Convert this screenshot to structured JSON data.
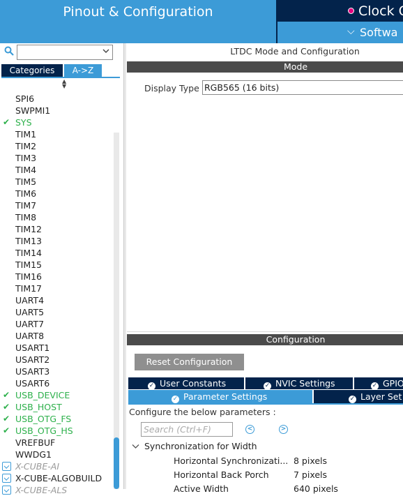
{
  "header": {
    "main_tab": "Pinout & Configuration",
    "clock_tab": "Clock C",
    "software_tab": "Softwa",
    "chevron_glyph": "❯"
  },
  "left_panel": {
    "search": {
      "value": "",
      "placeholder": ""
    },
    "tabs": {
      "categories": "Categories",
      "az": "A->Z",
      "active": "A->Z"
    },
    "items": [
      {
        "label": "SPI6",
        "status": "none"
      },
      {
        "label": "SWPMI1",
        "status": "none"
      },
      {
        "label": "SYS",
        "status": "configured"
      },
      {
        "label": "TIM1",
        "status": "none"
      },
      {
        "label": "TIM2",
        "status": "none"
      },
      {
        "label": "TIM3",
        "status": "none"
      },
      {
        "label": "TIM4",
        "status": "none"
      },
      {
        "label": "TIM5",
        "status": "none"
      },
      {
        "label": "TIM6",
        "status": "none"
      },
      {
        "label": "TIM7",
        "status": "none"
      },
      {
        "label": "TIM8",
        "status": "none"
      },
      {
        "label": "TIM12",
        "status": "none"
      },
      {
        "label": "TIM13",
        "status": "none"
      },
      {
        "label": "TIM14",
        "status": "none"
      },
      {
        "label": "TIM15",
        "status": "none"
      },
      {
        "label": "TIM16",
        "status": "none"
      },
      {
        "label": "TIM17",
        "status": "none"
      },
      {
        "label": "UART4",
        "status": "none"
      },
      {
        "label": "UART5",
        "status": "none"
      },
      {
        "label": "UART7",
        "status": "none"
      },
      {
        "label": "UART8",
        "status": "none"
      },
      {
        "label": "USART1",
        "status": "none"
      },
      {
        "label": "USART2",
        "status": "none"
      },
      {
        "label": "USART3",
        "status": "none"
      },
      {
        "label": "USART6",
        "status": "none"
      },
      {
        "label": "USB_DEVICE",
        "status": "configured"
      },
      {
        "label": "USB_HOST",
        "status": "configured"
      },
      {
        "label": "USB_OTG_FS",
        "status": "configured"
      },
      {
        "label": "USB_OTG_HS",
        "status": "configured"
      },
      {
        "label": "VREFBUF",
        "status": "none"
      },
      {
        "label": "WWDG1",
        "status": "none"
      },
      {
        "label": "X-CUBE-AI",
        "status": "package-faded"
      },
      {
        "label": "X-CUBE-ALGOBUILD",
        "status": "package"
      },
      {
        "label": "X-CUBE-ALS",
        "status": "package-faded"
      }
    ]
  },
  "main": {
    "title": "LTDC Mode and Configuration",
    "mode_header": "Mode",
    "display_type_label": "Display Type",
    "display_type_value": "RGB565 (16 bits)",
    "configuration_header": "Configuration",
    "reset_button": "Reset Configuration",
    "tabs_row1": [
      "User Constants",
      "NVIC Settings",
      "GPIO"
    ],
    "tabs_row2": [
      "Parameter Settings",
      "Layer Set"
    ],
    "active_tab": "Parameter Settings",
    "configure_text": "Configure the below parameters :",
    "param_search_placeholder": "Search (Ctrl+F)",
    "group_label": "Synchronization for Width",
    "params": [
      {
        "name": "Horizontal Synchronizati...",
        "value": "8 pixels"
      },
      {
        "name": "Horizontal Back Porch",
        "value": "7 pixels"
      },
      {
        "name": "Active Width",
        "value": "640 pixels"
      }
    ]
  },
  "colors": {
    "accent": "#3c9bd7",
    "dark_navy": "#03234b",
    "ok_green": "#2db04b",
    "bar_gray": "#4b4b4b"
  }
}
